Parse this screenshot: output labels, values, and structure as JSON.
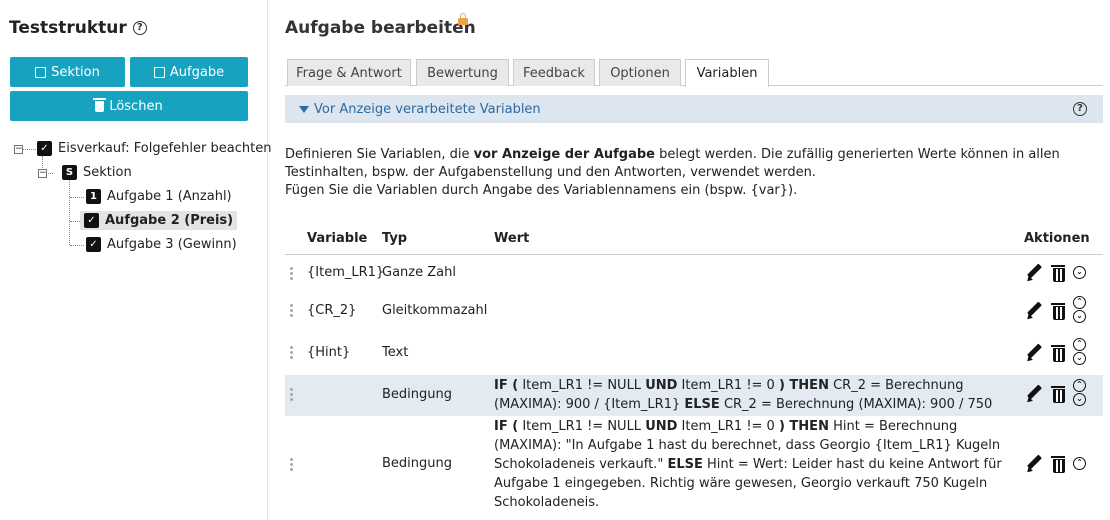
{
  "sidebar": {
    "title": "Teststruktur",
    "buttons": {
      "section": "Sektion",
      "task": "Aufgabe",
      "delete": "Löschen"
    },
    "tree": {
      "root": "Eisverkauf: Folgefehler beachten",
      "section": "Sektion",
      "tasks": [
        "Aufgabe 1 (Anzahl)",
        "Aufgabe 2 (Preis)",
        "Aufgabe 3 (Gewinn)"
      ],
      "selected_index": 1
    }
  },
  "main": {
    "title": "Aufgabe bearbeiten",
    "tabs": [
      "Frage & Antwort",
      "Bewertung",
      "Feedback",
      "Optionen",
      "Variablen"
    ],
    "active_tab": "Variablen",
    "section_title": "Vor Anzeige verarbeitete Variablen",
    "description": {
      "line1_a": "Definieren Sie Variablen, die ",
      "line1_b": "vor Anzeige der Aufgabe",
      "line1_c": " belegt werden. Die zufällig generierten Werte können in allen",
      "line2": "Testinhalten, bspw. der Aufgabenstellung und den Antworten, verwendet werden.",
      "line3": "Fügen Sie die Variablen durch Angabe des Variablennamens ein (bspw. {var})."
    },
    "table": {
      "headers": {
        "variable": "Variable",
        "type": "Typ",
        "value": "Wert",
        "actions": "Aktionen"
      },
      "rows": [
        {
          "variable": "{Item_LR1}",
          "type": "Ganze Zahl",
          "value": ""
        },
        {
          "variable": "{CR_2}",
          "type": "Gleitkommazahl",
          "value": ""
        },
        {
          "variable": "{Hint}",
          "type": "Text",
          "value": ""
        },
        {
          "variable": "",
          "type": "Bedingung",
          "cond": {
            "if": "IF (",
            "c1": " Item_LR1 != NULL ",
            "und": "UND",
            "c2": " Item_LR1 != 0 ",
            "then": ") THEN",
            "t1": " CR_2 = Berechnung (MAXIMA): 900 / {Item_LR1} ",
            "else": "ELSE",
            "e1": " CR_2 = Berechnung (MAXIMA): 900 / 750"
          }
        },
        {
          "variable": "",
          "type": "Bedingung",
          "cond": {
            "if": "IF (",
            "c1": " Item_LR1 != NULL ",
            "und": "UND",
            "c2": " Item_LR1 != 0 ",
            "then": ") THEN",
            "t1": " Hint = Berechnung (MAXIMA): \"In Aufgabe 1 hast du berechnet, dass Georgio {Item_LR1} Kugeln Schokoladeneis verkauft.\" ",
            "else": "ELSE",
            "e1": " Hint = Wert: Leider hast du keine Antwort für Aufgabe 1 eingegeben. Richtig wäre gewesen, Georgio verkauft 750 Kugeln Schokoladeneis."
          }
        }
      ]
    }
  }
}
